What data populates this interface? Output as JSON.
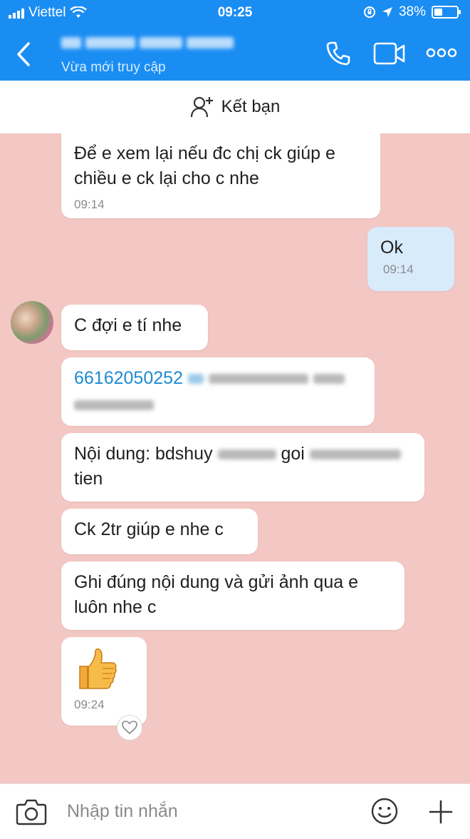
{
  "status_bar": {
    "carrier": "Viettel",
    "time": "09:25",
    "battery_percent": "38%",
    "battery_level": 0.38
  },
  "header": {
    "last_seen": "Vừa mới truy cập",
    "back_icon": "chevron-left-icon",
    "call_icon": "phone-icon",
    "video_icon": "video-camera-icon",
    "more_icon": "more-dots-icon",
    "color": "#1a8df3"
  },
  "add_friend": {
    "label": "Kết bạn",
    "icon": "add-friend-icon"
  },
  "messages": [
    {
      "direction": "in",
      "lines": [
        "Để e xem lại nếu đc chị ck giúp e",
        "chiều e ck lại cho c nhe"
      ],
      "time": "09:14"
    },
    {
      "direction": "out",
      "text": "Ok",
      "time": "09:14"
    },
    {
      "direction": "in",
      "text": "C đợi e tí nhe"
    },
    {
      "direction": "in",
      "account_number": "66162050252"
    },
    {
      "direction": "in",
      "content_prefix": "Nội dung: bdshuy",
      "content_mid": "goi",
      "content_line2": "tien"
    },
    {
      "direction": "in",
      "text": "Ck 2tr giúp e nhe c"
    },
    {
      "direction": "in",
      "lines": [
        "Ghi đúng nội dung và gửi ảnh qua e",
        "luôn nhe c"
      ]
    },
    {
      "direction": "in",
      "sticker": "thumbs-up-icon",
      "time": "09:24"
    }
  ],
  "input_bar": {
    "placeholder": "Nhập tin nhắn",
    "camera_icon": "camera-icon",
    "emoji_icon": "emoji-icon",
    "plus_icon": "plus-icon"
  },
  "colors": {
    "chat_background": "#f3c7c3",
    "incoming_bubble": "#ffffff",
    "outgoing_bubble": "#d7ebfb",
    "link": "#1e8ad1"
  }
}
